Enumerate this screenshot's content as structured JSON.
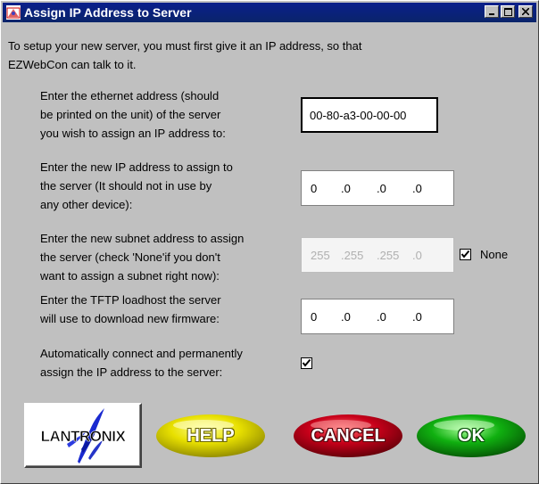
{
  "window": {
    "title": "Assign IP Address to Server"
  },
  "intro": {
    "line1": "To setup your new server, you must first give it an IP address, so that",
    "line2": "EZWebCon can talk to it."
  },
  "ethernet": {
    "label_lines": [
      "Enter the ethernet address (should",
      "be printed on the unit) of the server",
      "you wish to assign an IP address to:"
    ],
    "value": "00-80-a3-00-00-00"
  },
  "new_ip": {
    "label_lines": [
      "Enter the new IP address to assign to",
      "the server (It should not in use by",
      "any other device):"
    ],
    "octets": [
      "0",
      ".0",
      ".0",
      ".0"
    ]
  },
  "subnet": {
    "label_lines": [
      "Enter the new subnet address to assign",
      "the server (check 'None'if you don't",
      "want to assign a subnet right now):"
    ],
    "octets": [
      "255",
      ".255",
      ".255",
      ".0"
    ],
    "none_label": "None",
    "none_checked": true
  },
  "tftp": {
    "label_lines": [
      "Enter the TFTP loadhost the server",
      "will use to download new firmware:"
    ],
    "octets": [
      "0",
      ".0",
      ".0",
      ".0"
    ]
  },
  "auto_connect": {
    "label_lines": [
      "Automatically connect and permanently",
      "assign the IP address to the server:"
    ],
    "checked": true
  },
  "buttons": {
    "logo_text": "LANTRONIX",
    "help": "HELP",
    "cancel": "CANCEL",
    "ok": "OK"
  },
  "colors": {
    "title_bar": "#0a246a",
    "help": "#e8e000",
    "cancel": "#c8001a",
    "ok": "#10b010"
  }
}
